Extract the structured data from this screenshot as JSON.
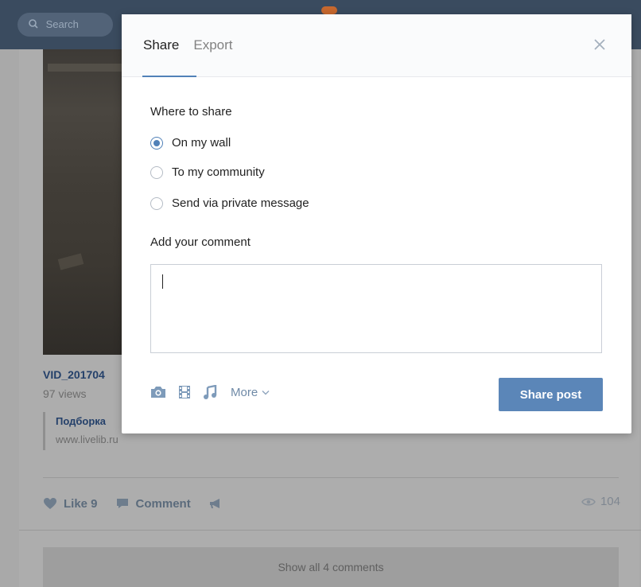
{
  "background": {
    "search_placeholder": "Search",
    "post_title": "VID_201704",
    "post_views": "97 views",
    "link_title": "Подборка",
    "link_url": "www.livelib.ru",
    "like_label": "Like 9",
    "comment_label": "Comment",
    "view_count": "104",
    "show_all_comments": "Show all 4 comments"
  },
  "modal": {
    "tabs": [
      {
        "label": "Share",
        "active": true
      },
      {
        "label": "Export",
        "active": false
      }
    ],
    "where_label": "Where to share",
    "options": [
      {
        "label": "On my wall",
        "checked": true
      },
      {
        "label": "To my community",
        "checked": false
      },
      {
        "label": "Send via private message",
        "checked": false
      }
    ],
    "comment_label": "Add your comment",
    "comment_value": "",
    "attach_icons": [
      "camera-icon",
      "video-icon",
      "music-icon"
    ],
    "more_label": "More",
    "submit_label": "Share post",
    "accent_color": "#5181b8"
  }
}
